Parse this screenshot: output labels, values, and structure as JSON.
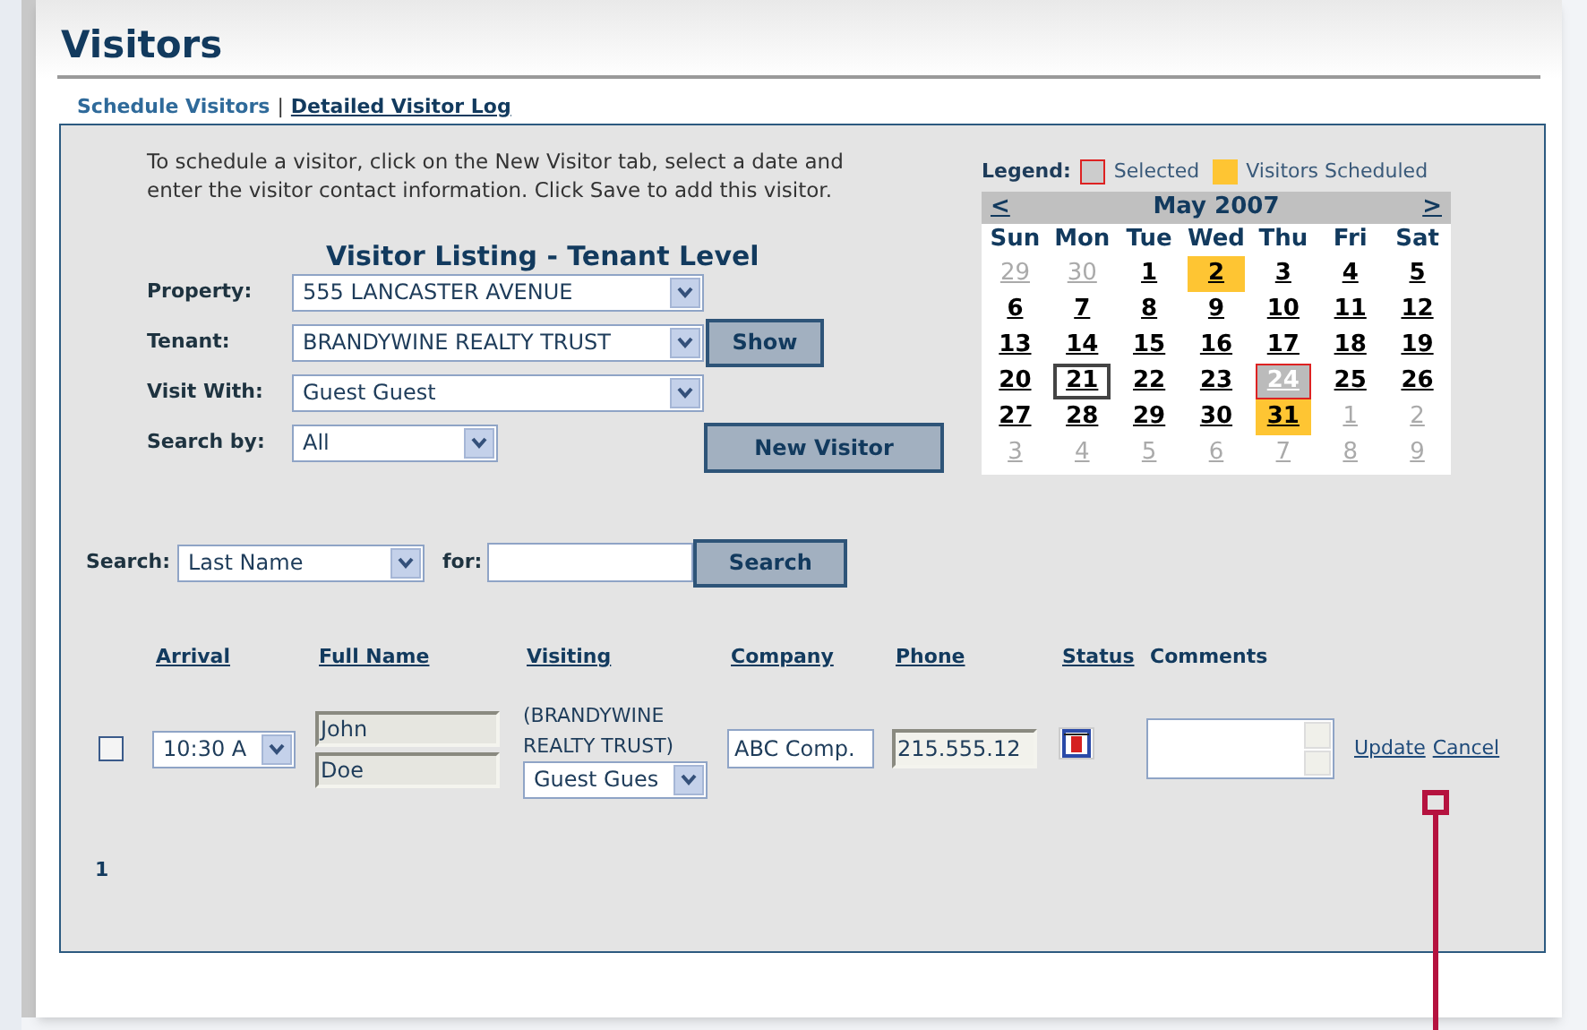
{
  "page": {
    "title": "Visitors"
  },
  "tabs": [
    {
      "label": "Schedule Visitors",
      "selected": true
    },
    {
      "label": "Detailed Visitor Log",
      "selected": false
    }
  ],
  "tab_separator": "|",
  "instructions": "To schedule a visitor, click on the New Visitor tab, select a date and enter the visitor contact information. Click Save to add this visitor.",
  "listing_title": "Visitor Listing - Tenant Level",
  "filters": [
    {
      "label": "Property:",
      "value": "555 LANCASTER AVENUE"
    },
    {
      "label": "Tenant:",
      "value": "BRANDYWINE REALTY TRUST"
    },
    {
      "label": "Visit With:",
      "value": "Guest Guest"
    },
    {
      "label": "Search by:",
      "value": "All"
    }
  ],
  "show_button": "Show",
  "new_visitor_button": "New Visitor",
  "legend": {
    "label": "Legend:",
    "items": [
      {
        "label": "Selected",
        "kind": "selected"
      },
      {
        "label": "Visitors Scheduled",
        "kind": "scheduled"
      }
    ]
  },
  "calendar": {
    "prev": "<",
    "month": "May 2007",
    "next": ">",
    "weekdays": [
      "Sun",
      "Mon",
      "Tue",
      "Wed",
      "Thu",
      "Fri",
      "Sat"
    ],
    "days": [
      {
        "label": "29",
        "kind": "other"
      },
      {
        "label": "30",
        "kind": "other"
      },
      {
        "label": "1",
        "kind": "day"
      },
      {
        "label": "2",
        "kind": "scheduled"
      },
      {
        "label": "3",
        "kind": "day"
      },
      {
        "label": "4",
        "kind": "day"
      },
      {
        "label": "5",
        "kind": "day"
      },
      {
        "label": "6",
        "kind": "day"
      },
      {
        "label": "7",
        "kind": "day"
      },
      {
        "label": "8",
        "kind": "day"
      },
      {
        "label": "9",
        "kind": "day"
      },
      {
        "label": "10",
        "kind": "day"
      },
      {
        "label": "11",
        "kind": "day"
      },
      {
        "label": "12",
        "kind": "day"
      },
      {
        "label": "13",
        "kind": "day"
      },
      {
        "label": "14",
        "kind": "day"
      },
      {
        "label": "15",
        "kind": "day"
      },
      {
        "label": "16",
        "kind": "day"
      },
      {
        "label": "17",
        "kind": "day"
      },
      {
        "label": "18",
        "kind": "day"
      },
      {
        "label": "19",
        "kind": "day"
      },
      {
        "label": "20",
        "kind": "day"
      },
      {
        "label": "21",
        "kind": "today"
      },
      {
        "label": "22",
        "kind": "day"
      },
      {
        "label": "23",
        "kind": "day"
      },
      {
        "label": "24",
        "kind": "selected"
      },
      {
        "label": "25",
        "kind": "day"
      },
      {
        "label": "26",
        "kind": "day"
      },
      {
        "label": "27",
        "kind": "day"
      },
      {
        "label": "28",
        "kind": "day"
      },
      {
        "label": "29",
        "kind": "day"
      },
      {
        "label": "30",
        "kind": "day"
      },
      {
        "label": "31",
        "kind": "scheduled"
      },
      {
        "label": "1",
        "kind": "other"
      },
      {
        "label": "2",
        "kind": "other"
      },
      {
        "label": "3",
        "kind": "other"
      },
      {
        "label": "4",
        "kind": "other"
      },
      {
        "label": "5",
        "kind": "other"
      },
      {
        "label": "6",
        "kind": "other"
      },
      {
        "label": "7",
        "kind": "other"
      },
      {
        "label": "8",
        "kind": "other"
      },
      {
        "label": "9",
        "kind": "other"
      }
    ]
  },
  "search": {
    "label": "Search:",
    "field": "Last Name",
    "for_label": "for:",
    "button": "Search"
  },
  "table": {
    "columns": [
      {
        "label": "Arrival",
        "sortable": true
      },
      {
        "label": "Full Name",
        "sortable": true
      },
      {
        "label": "Visiting",
        "sortable": true
      },
      {
        "label": "Company",
        "sortable": true
      },
      {
        "label": "Phone",
        "sortable": true
      },
      {
        "label": "Status",
        "sortable": true
      },
      {
        "label": "Comments",
        "sortable": false
      }
    ],
    "rows": [
      {
        "checked": false,
        "arrival": "10:30 A",
        "first_name": "John",
        "last_name": "Doe",
        "visiting_tenant": "(BRANDYWINE REALTY TRUST)",
        "visiting_person": "Guest Gues",
        "company": "ABC Comp.",
        "phone": "215.555.12",
        "actions": [
          "Update",
          "Cancel"
        ]
      }
    ]
  },
  "pager": "1"
}
